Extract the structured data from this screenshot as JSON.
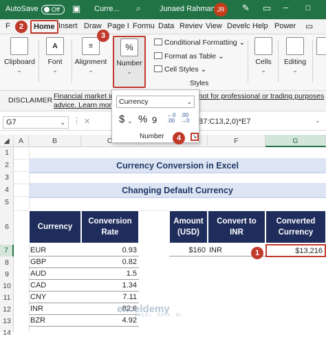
{
  "titlebar": {
    "autosave": "AutoSave",
    "toggle": "Off",
    "filename": "Curre...",
    "user": "Junaed Rahman",
    "initials": "JR"
  },
  "tabs": [
    "F",
    "Home",
    "Insert",
    "Draw",
    "Page I",
    "Formu",
    "Data",
    "Reviev",
    "View",
    "Develc",
    "Help",
    "Power"
  ],
  "ribbon": {
    "clipboard": "Clipboard",
    "font": "Font",
    "alignment": "Alignment",
    "number": "Number",
    "conditional_formatting": "Conditional Formatting",
    "format_as_table": "Format as Table",
    "cell_styles": "Cell Styles",
    "styles_group": "Styles",
    "cells": "Cells",
    "editing": "Editing",
    "add": "Ad"
  },
  "badges": {
    "b1": "1",
    "b2": "2",
    "b3": "3",
    "b4": "4"
  },
  "disclaimer": {
    "label": "DISCLAIMER",
    "text_line1": "Financial market inf                                    nd not for professional or trading purposes",
    "text_line2": "advice. Learn more."
  },
  "formula_bar": {
    "namebox": "G7",
    "formula": "B7:C13,2,0)*E7",
    "cancel_glyph": "✕"
  },
  "popup": {
    "format": "Currency",
    "currency_symbol": "$",
    "percent_symbol": "%",
    "comma_symbol": "9",
    "label": "Number"
  },
  "columns": [
    "A",
    "B",
    "C",
    "E",
    "F",
    "G"
  ],
  "rows": [
    "1",
    "2",
    "3",
    "4",
    "5",
    "6",
    "7",
    "8",
    "9",
    "10",
    "11",
    "12",
    "13",
    "14"
  ],
  "sheet": {
    "title": "Currency Conversion in Excel",
    "subtitle": "Changing Default Currency",
    "left_table": {
      "headers": [
        "Currency",
        "Conversion Rate"
      ],
      "rows": [
        [
          "EUR",
          "0.93"
        ],
        [
          "GBP",
          "0.82"
        ],
        [
          "AUD",
          "1.5"
        ],
        [
          "CAD",
          "1.34"
        ],
        [
          "CNY",
          "7.11"
        ],
        [
          "INR",
          "82.6"
        ],
        [
          "BZR",
          "4.92"
        ]
      ]
    },
    "right_table": {
      "headers": [
        "Amount (USD)",
        "Convert to INR",
        "Converted Currency"
      ],
      "row": [
        "$160",
        "INR",
        "$13,216"
      ]
    }
  },
  "watermark": {
    "name": "exceldemy",
    "tag": "EXCEL · DATA · BI"
  }
}
